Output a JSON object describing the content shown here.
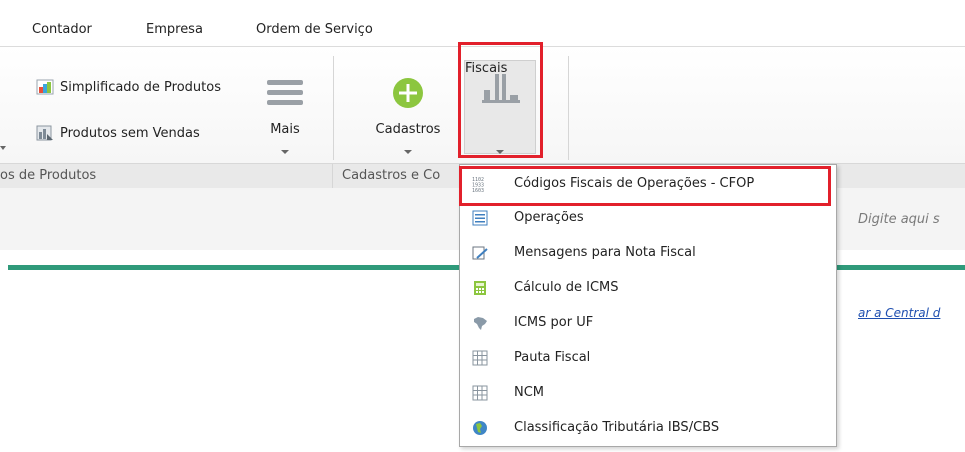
{
  "menubar": {
    "tabs": [
      {
        "label": "Contador"
      },
      {
        "label": "Empresa"
      },
      {
        "label": "Ordem de Serviço"
      }
    ]
  },
  "ribbon": {
    "small_buttons": [
      {
        "label": "Simplificado de Produtos",
        "icon": "colorful-chart-icon"
      },
      {
        "label": "Produtos sem Vendas",
        "icon": "product-chart-icon"
      }
    ],
    "mais_label": "Mais",
    "cadastros_label": "Cadastros",
    "fiscais_label": "Fiscais",
    "group_labels": [
      "os de Produtos",
      "Cadastros e Co"
    ]
  },
  "search": {
    "placeholder": "Digite aqui s"
  },
  "link": {
    "text": "ar a Central d"
  },
  "dropdown": {
    "items": [
      {
        "label": "Códigos Fiscais de Operações - CFOP",
        "icon": "cfop-numbers-icon"
      },
      {
        "label": "Operações",
        "icon": "list-icon"
      },
      {
        "label": "Mensagens para Nota Fiscal",
        "icon": "edit-message-icon"
      },
      {
        "label": "Cálculo de ICMS",
        "icon": "calculator-icon"
      },
      {
        "label": "ICMS por UF",
        "icon": "brazil-map-icon"
      },
      {
        "label": "Pauta Fiscal",
        "icon": "table-icon"
      },
      {
        "label": "NCM",
        "icon": "table-icon"
      },
      {
        "label": "Classificação Tributária IBS/CBS",
        "icon": "globe-icon"
      }
    ]
  },
  "colors": {
    "highlight": "#e2202b",
    "accent_green": "#2f9a7a",
    "add_green": "#8cc63f",
    "link_blue": "#1f4fb0"
  }
}
